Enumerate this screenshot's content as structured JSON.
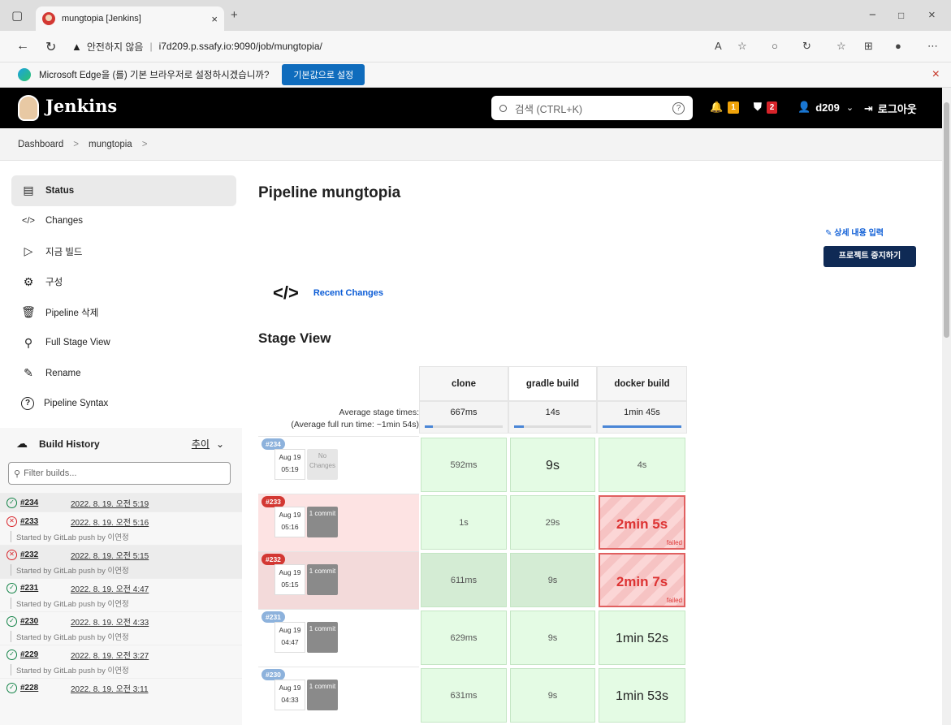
{
  "browser": {
    "tab_title": "mungtopia [Jenkins]",
    "tab_close": "×",
    "new_tab": "+",
    "security": "안전하지 않음",
    "url": "i7d209.p.ssafy.io:9090/job/mungtopia/",
    "window_buttons": [
      "−",
      "□",
      "×"
    ],
    "infobar": {
      "message": "Microsoft Edge을 (를) 기본 브라우저로 설정하시겠습니까?",
      "button": "기본값으로 설정",
      "close": "×"
    }
  },
  "header": {
    "title": "Jenkins",
    "search_placeholder": "검색 (CTRL+K)",
    "help": "?",
    "notifications": "1",
    "security_count": "2",
    "user": "d209",
    "logout": "로그아웃"
  },
  "breadcrumb": [
    "Dashboard",
    "mungtopia"
  ],
  "breadcrumb_sep": ">",
  "sidebar": [
    {
      "icon": "status-icon",
      "glyph": "▤",
      "label": "Status"
    },
    {
      "icon": "code-icon",
      "glyph": "</>",
      "label": "Changes"
    },
    {
      "icon": "play-icon",
      "glyph": "▷",
      "label": "지금 빌드"
    },
    {
      "icon": "gear-icon",
      "glyph": "⚙",
      "label": "구성"
    },
    {
      "icon": "trash-icon",
      "glyph": "🗑",
      "label": "Pipeline 삭제"
    },
    {
      "icon": "search-icon",
      "glyph": "⚲",
      "label": "Full Stage View"
    },
    {
      "icon": "pencil-icon",
      "glyph": "✎",
      "label": "Rename"
    },
    {
      "icon": "help-icon",
      "glyph": "?",
      "label": "Pipeline Syntax"
    }
  ],
  "build_history": {
    "title": "Build History",
    "trend": "추이",
    "filter_placeholder": "Filter builds...",
    "builds": [
      {
        "status": "ok",
        "number": "#234",
        "date": "2022. 8. 19. 오전 5:19",
        "cause": ""
      },
      {
        "status": "bad",
        "number": "#233",
        "date": "2022. 8. 19. 오전 5:16",
        "cause": "Started by GitLab push by 이연정"
      },
      {
        "status": "bad",
        "number": "#232",
        "date": "2022. 8. 19. 오전 5:15",
        "cause": "Started by GitLab push by 이연정"
      },
      {
        "status": "ok",
        "number": "#231",
        "date": "2022. 8. 19. 오전 4:47",
        "cause": "Started by GitLab push by 이연정"
      },
      {
        "status": "ok",
        "number": "#230",
        "date": "2022. 8. 19. 오전 4:33",
        "cause": "Started by GitLab push by 이연정"
      },
      {
        "status": "ok",
        "number": "#229",
        "date": "2022. 8. 19. 오전 3:27",
        "cause": "Started by GitLab push by 이연정"
      },
      {
        "status": "ok",
        "number": "#228",
        "date": "2022. 8. 19. 오전 3:11",
        "cause": ""
      }
    ]
  },
  "main": {
    "title": "Pipeline mungtopia",
    "edit_description": "상세 내용 입력",
    "disable_button": "프로젝트 중지하기",
    "recent_changes": "Recent Changes",
    "stage_view_title": "Stage View",
    "avg_label": "Average stage times:",
    "avg_full": "(Average full run time: ~1min 54s)"
  },
  "stage_view": {
    "stages": [
      "clone",
      "gradle build",
      "docker build"
    ],
    "averages": [
      "667ms",
      "14s",
      "1min 45s"
    ],
    "average_fill": [
      0.1,
      0.13,
      1.0
    ],
    "runs": [
      {
        "id": "#234",
        "date": "Aug 19",
        "time": "05:19",
        "changes": "No Changes",
        "failed": false,
        "cells": [
          "592ms",
          "9s",
          "4s"
        ]
      },
      {
        "id": "#233",
        "date": "Aug 19",
        "time": "05:16",
        "changes": "1 commit",
        "failed": true,
        "cells": [
          "1s",
          "29s",
          "2min 5s"
        ]
      },
      {
        "id": "#232",
        "date": "Aug 19",
        "time": "05:15",
        "changes": "1 commit",
        "failed": true,
        "cells": [
          "611ms",
          "9s",
          "2min 7s"
        ]
      },
      {
        "id": "#231",
        "date": "Aug 19",
        "time": "04:47",
        "changes": "1 commit",
        "failed": false,
        "cells": [
          "629ms",
          "9s",
          "1min 52s"
        ]
      },
      {
        "id": "#230",
        "date": "Aug 19",
        "time": "04:33",
        "changes": "1 commit",
        "failed": false,
        "cells": [
          "631ms",
          "9s",
          "1min 53s"
        ]
      }
    ],
    "failed_label": "failed"
  }
}
